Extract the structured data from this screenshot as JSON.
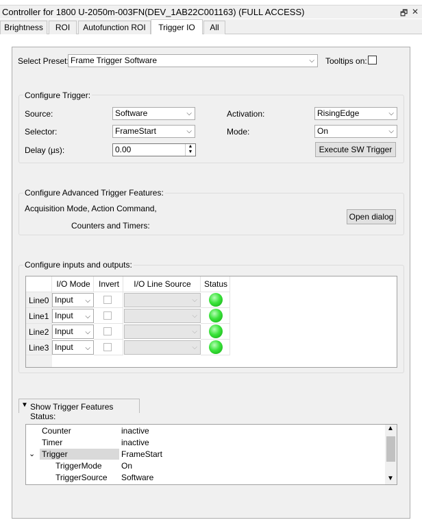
{
  "window": {
    "title": "Controller for 1800 U-2050m-003FN(DEV_1AB22C001163) (FULL ACCESS)",
    "restore_glyph": "🗗",
    "close_glyph": "✕"
  },
  "tabs": [
    {
      "label": "Brightness",
      "active": false
    },
    {
      "label": "ROI",
      "active": false
    },
    {
      "label": "Autofunction ROI",
      "active": false
    },
    {
      "label": "Trigger IO",
      "active": true
    },
    {
      "label": "All",
      "active": false
    }
  ],
  "preset": {
    "label": "Select Preset:",
    "value": "Frame Trigger Software",
    "tooltips_label": "Tooltips on:",
    "tooltips_checked": false
  },
  "configure_trigger": {
    "title": "Configure Trigger:",
    "source_label": "Source:",
    "source_value": "Software",
    "selector_label": "Selector:",
    "selector_value": "FrameStart",
    "delay_label": "Delay (µs):",
    "delay_value": "0.00",
    "activation_label": "Activation:",
    "activation_value": "RisingEdge",
    "mode_label": "Mode:",
    "mode_value": "On",
    "execute_button": "Execute SW Trigger"
  },
  "advanced": {
    "title": "Configure Advanced Trigger Features:",
    "line1": "Acquisition Mode, Action Command,",
    "line2": "Counters and Timers:",
    "open_button": "Open dialog"
  },
  "io": {
    "title": "Configure inputs and outputs:",
    "headers": {
      "mode": "I/O Mode",
      "invert": "Invert",
      "source": "I/O Line Source",
      "status": "Status"
    },
    "rows": [
      {
        "line": "Line0",
        "mode": "Input",
        "invert": false,
        "source": "",
        "status": "ok"
      },
      {
        "line": "Line1",
        "mode": "Input",
        "invert": false,
        "source": "",
        "status": "ok"
      },
      {
        "line": "Line2",
        "mode": "Input",
        "invert": false,
        "source": "",
        "status": "ok"
      },
      {
        "line": "Line3",
        "mode": "Input",
        "invert": false,
        "source": "",
        "status": "ok"
      }
    ]
  },
  "status_section": {
    "toggle_label": "Show Trigger Features Status:",
    "tree": [
      {
        "name": "Counter",
        "value": "inactive",
        "indent": 0,
        "expanded": null,
        "selected": false
      },
      {
        "name": "Timer",
        "value": "inactive",
        "indent": 0,
        "expanded": null,
        "selected": false
      },
      {
        "name": "Trigger",
        "value": "FrameStart",
        "indent": 0,
        "expanded": true,
        "selected": true
      },
      {
        "name": "TriggerMode",
        "value": "On",
        "indent": 1,
        "expanded": null,
        "selected": false
      },
      {
        "name": "TriggerSource",
        "value": "Software",
        "indent": 1,
        "expanded": null,
        "selected": false
      }
    ]
  },
  "icons": {
    "dropdown": "chevron-down-icon",
    "collapse": "triangle-down-icon",
    "status_ok": "green-led-icon"
  },
  "colors": {
    "panel_bg": "#f0f0f0",
    "status_ok": "#2ed82e",
    "selected_row": "#d9d9d9"
  }
}
